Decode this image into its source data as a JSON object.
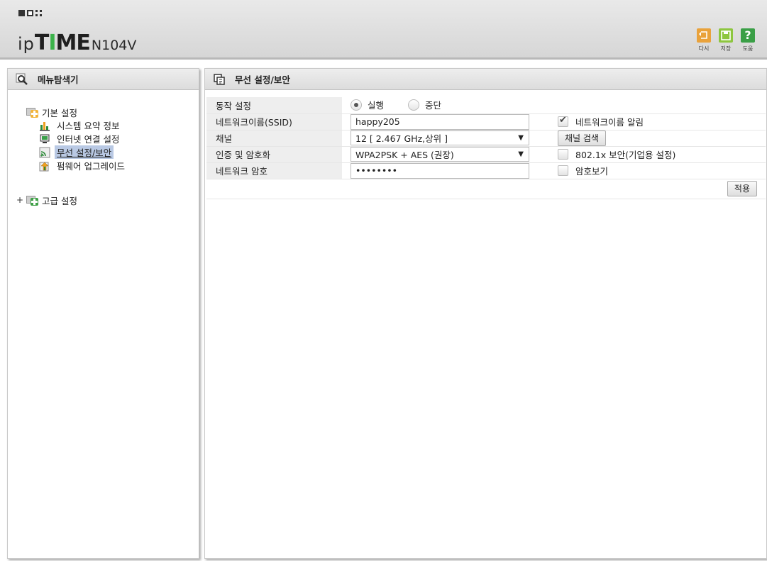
{
  "header": {
    "logo_ip": "ip",
    "logo_time_part1": "T",
    "logo_time_part2": "I",
    "logo_time_part3": "M",
    "logo_time_part4": "E",
    "model": "N104V",
    "buttons": [
      {
        "label": "다시",
        "icon": "undo-icon",
        "color": "#e9a23b"
      },
      {
        "label": "저장",
        "icon": "save-icon",
        "color": "#8dc63f"
      },
      {
        "label": "도움",
        "icon": "help-icon",
        "color": "#3a9f46"
      }
    ]
  },
  "menu_panel": {
    "title": "메뉴탐색기",
    "basic": {
      "label": "기본 설정",
      "items": [
        {
          "label": "시스템 요약 정보",
          "icon": "chart-icon"
        },
        {
          "label": "인터넷 연결 설정",
          "icon": "monitor-icon"
        },
        {
          "label": "무선 설정/보안",
          "icon": "wireless-icon",
          "active": true
        },
        {
          "label": "펌웨어 업그레이드",
          "icon": "upgrade-icon"
        }
      ]
    },
    "advanced": {
      "expander": "+",
      "label": "고급 설정"
    }
  },
  "content": {
    "title": "무선 설정/보안",
    "rows": {
      "operation": {
        "label": "동작 설정",
        "options": [
          "실행",
          "중단"
        ],
        "selected": "실행"
      },
      "ssid": {
        "label": "네트워크이름(SSID)",
        "value": "happy205",
        "broadcast_label": "네트워크이름 알림",
        "broadcast_checked": true
      },
      "channel": {
        "label": "채널",
        "value": "12 [ 2.467 GHz,상위 ]",
        "scan_button": "채널 검색"
      },
      "auth": {
        "label": "인증 및 암호화",
        "value": "WPA2PSK + AES (권장)",
        "enterprise_label": "802.1x 보안(기업용 설정)",
        "enterprise_checked": false
      },
      "password": {
        "label": "네트워크 암호",
        "value": "••••••••",
        "show_label": "암호보기",
        "show_checked": false
      }
    },
    "apply_button": "적용"
  }
}
